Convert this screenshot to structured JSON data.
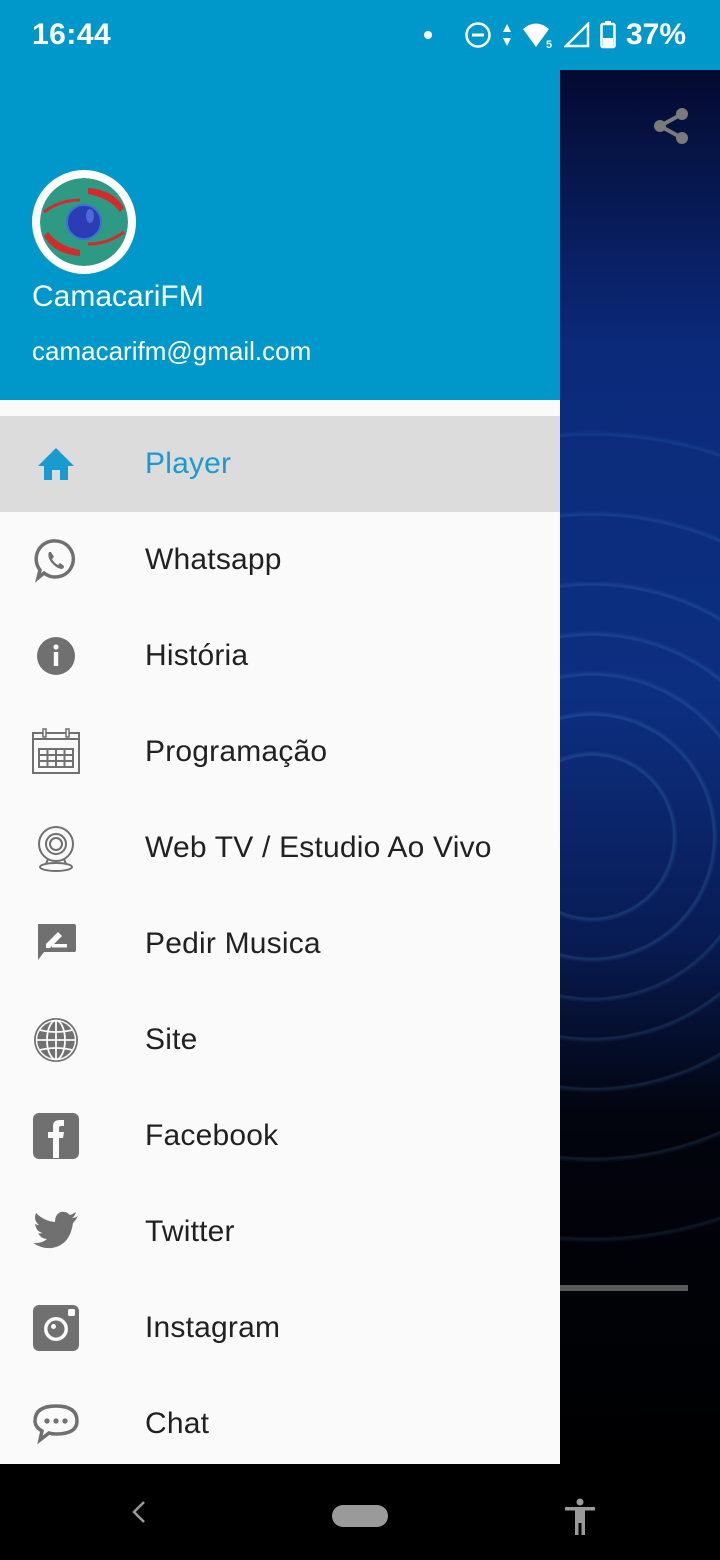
{
  "status_bar": {
    "time": "16:44",
    "battery_percent": "37%",
    "icons": [
      "notification-dot",
      "do-not-disturb-icon",
      "data-arrows-icon",
      "wifi-icon",
      "cell-signal-icon",
      "battery-icon"
    ]
  },
  "drawer": {
    "header": {
      "app_name": "CamacariFM",
      "email": "camacarifm@gmail.com",
      "accent_color": "#0098cb"
    },
    "items": [
      {
        "label": "Player",
        "icon": "home-icon",
        "active": true
      },
      {
        "label": "Whatsapp",
        "icon": "whatsapp-icon",
        "active": false
      },
      {
        "label": "História",
        "icon": "info-icon",
        "active": false
      },
      {
        "label": "Programação",
        "icon": "calendar-icon",
        "active": false
      },
      {
        "label": "Web TV / Estudio Ao Vivo",
        "icon": "webcam-icon",
        "active": false
      },
      {
        "label": "Pedir Musica",
        "icon": "message-edit-icon",
        "active": false
      },
      {
        "label": "Site",
        "icon": "globe-icon",
        "active": false
      },
      {
        "label": "Facebook",
        "icon": "facebook-icon",
        "active": false
      },
      {
        "label": "Twitter",
        "icon": "twitter-icon",
        "active": false
      },
      {
        "label": "Instagram",
        "icon": "instagram-icon",
        "active": false
      },
      {
        "label": "Chat",
        "icon": "chat-icon",
        "active": false
      }
    ],
    "active_color": "#1a9bd0",
    "icon_color": "#707070"
  },
  "background_app": {
    "share_icon": "share-icon"
  },
  "nav_bar": {
    "buttons": [
      "back-icon",
      "home-pill",
      "accessibility-icon"
    ]
  }
}
